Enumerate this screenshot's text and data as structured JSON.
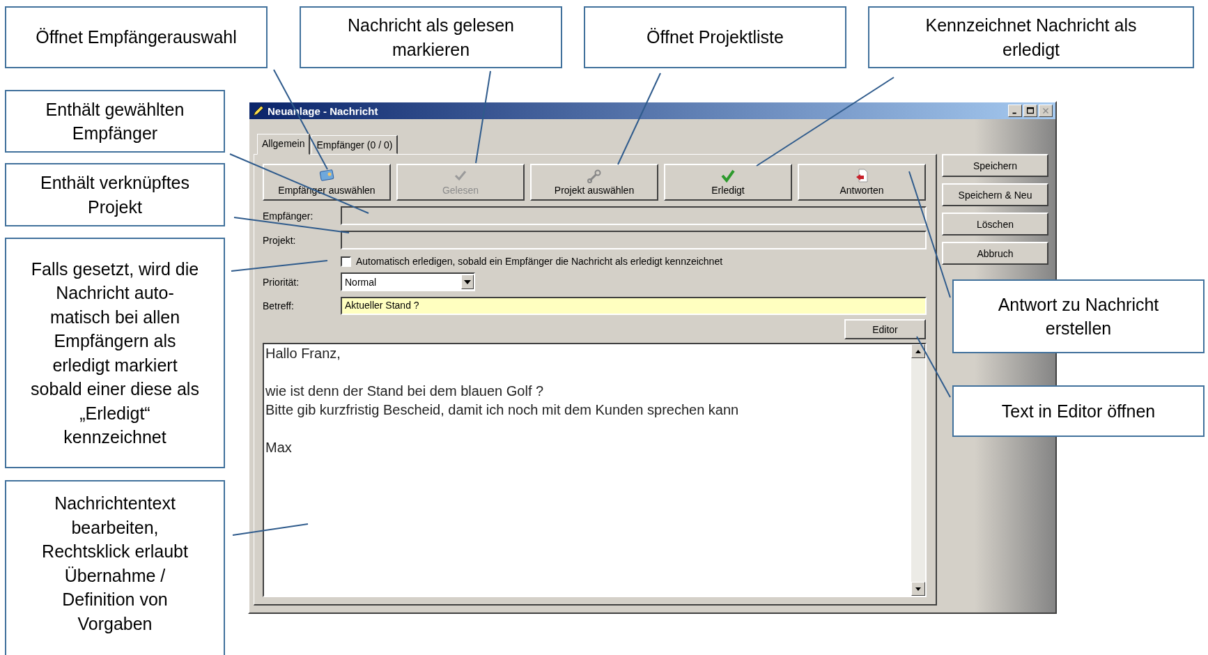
{
  "callouts": [
    {
      "text": "Öffnet Empfängerauswahl"
    },
    {
      "text": "Nachricht als gelesen\nmarkieren"
    },
    {
      "text": "Öffnet Projektliste"
    },
    {
      "text": "Kennzeichnet Nachricht als\nerledigt"
    },
    {
      "text": "Enthält gewählten\nEmpfänger"
    },
    {
      "text": "Enthält verknüpftes\nProjekt"
    },
    {
      "text": "Falls gesetzt, wird die\nNachricht auto-\nmatisch bei allen\nEmpfängern als\nerledigt markiert\nsobald einer diese als\n„Erledigt“\nkennzeichnet"
    },
    {
      "text": "Nachrichtentext\nbearbeiten,\nRechtsklick erlaubt\nÜbernahme /\nDefinition von\nVorgaben"
    },
    {
      "text": "Antwort zu Nachricht\nerstellen"
    },
    {
      "text": "Text in Editor öffnen"
    }
  ],
  "window": {
    "title": "Neuanlage - Nachricht",
    "tabs": [
      {
        "label": "Allgemein",
        "selected": true
      },
      {
        "label": "Empfänger (0 / 0)",
        "selected": false
      }
    ],
    "toolbar": [
      {
        "label": "Empfänger auswählen",
        "kind": "card",
        "disabled": false
      },
      {
        "label": "Gelesen",
        "kind": "tick",
        "disabled": true
      },
      {
        "label": "Projekt auswählen",
        "kind": "wrench",
        "disabled": false
      },
      {
        "label": "Erledigt",
        "kind": "check",
        "disabled": false
      },
      {
        "label": "Antworten",
        "kind": "reply",
        "disabled": false
      }
    ],
    "recipient": {
      "label": "Empfänger:"
    },
    "project": {
      "label": "Projekt:"
    },
    "auto_done": {
      "label": "Automatisch erledigen, sobald ein Empfänger die Nachricht als erledigt kennzeichnet",
      "checked": false
    },
    "priority": {
      "label": "Priorität:",
      "value": "Normal"
    },
    "subject": {
      "label": "Betreff:",
      "value": "Aktueller Stand ?"
    },
    "editor_button": "Editor",
    "body": "Hallo Franz,\n\nwie ist denn der Stand bei dem blauen Golf ?\nBitte gib kurzfristig Bescheid, damit ich noch mit dem Kunden sprechen kann\n\nMax",
    "side_buttons": [
      "Speichern",
      "Speichern & Neu",
      "Löschen",
      "Abbruch"
    ]
  }
}
